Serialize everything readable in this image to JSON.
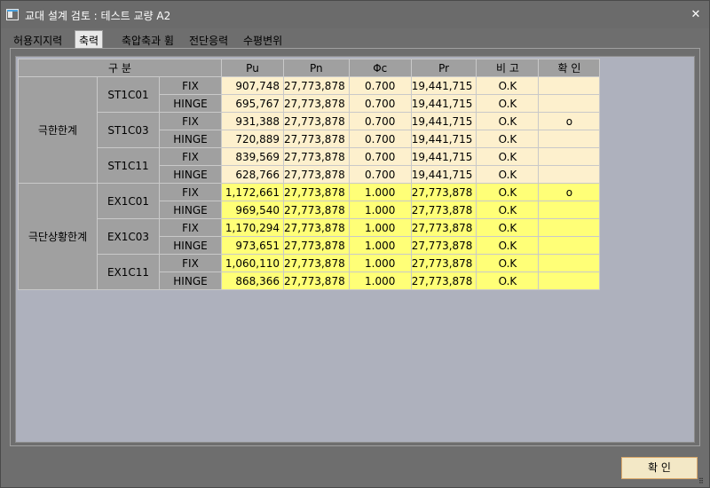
{
  "window": {
    "title": "교대 설계 검토 : 테스트 교량 A2",
    "close_glyph": "✕"
  },
  "tabs": [
    {
      "label": "허용지지력",
      "active": false
    },
    {
      "label": "축력",
      "active": true
    },
    {
      "label": "축압축과 휨",
      "active": false
    },
    {
      "label": "전단응력",
      "active": false
    },
    {
      "label": "수평변위",
      "active": false
    }
  ],
  "table": {
    "headers": {
      "category": "구 분",
      "pu": "Pu",
      "pn": "Pn",
      "phic": "Φc",
      "pr": "Pr",
      "remark": "비 고",
      "check": "확 인"
    },
    "groups": [
      {
        "label": "극한한계",
        "kind": "st",
        "subgroups": [
          {
            "label": "ST1C01",
            "rows": [
              {
                "type": "FIX",
                "pu": "907,748",
                "pn": "27,773,878",
                "phic": "0.700",
                "pr": "19,441,715",
                "remark": "O.K",
                "check": ""
              },
              {
                "type": "HINGE",
                "pu": "695,767",
                "pn": "27,773,878",
                "phic": "0.700",
                "pr": "19,441,715",
                "remark": "O.K",
                "check": ""
              }
            ]
          },
          {
            "label": "ST1C03",
            "rows": [
              {
                "type": "FIX",
                "pu": "931,388",
                "pn": "27,773,878",
                "phic": "0.700",
                "pr": "19,441,715",
                "remark": "O.K",
                "check": "o"
              },
              {
                "type": "HINGE",
                "pu": "720,889",
                "pn": "27,773,878",
                "phic": "0.700",
                "pr": "19,441,715",
                "remark": "O.K",
                "check": ""
              }
            ]
          },
          {
            "label": "ST1C11",
            "rows": [
              {
                "type": "FIX",
                "pu": "839,569",
                "pn": "27,773,878",
                "phic": "0.700",
                "pr": "19,441,715",
                "remark": "O.K",
                "check": ""
              },
              {
                "type": "HINGE",
                "pu": "628,766",
                "pn": "27,773,878",
                "phic": "0.700",
                "pr": "19,441,715",
                "remark": "O.K",
                "check": ""
              }
            ]
          }
        ]
      },
      {
        "label": "극단상황한계",
        "kind": "ex",
        "subgroups": [
          {
            "label": "EX1C01",
            "rows": [
              {
                "type": "FIX",
                "pu": "1,172,661",
                "pn": "27,773,878",
                "phic": "1.000",
                "pr": "27,773,878",
                "remark": "O.K",
                "check": "o"
              },
              {
                "type": "HINGE",
                "pu": "969,540",
                "pn": "27,773,878",
                "phic": "1.000",
                "pr": "27,773,878",
                "remark": "O.K",
                "check": ""
              }
            ]
          },
          {
            "label": "EX1C03",
            "rows": [
              {
                "type": "FIX",
                "pu": "1,170,294",
                "pn": "27,773,878",
                "phic": "1.000",
                "pr": "27,773,878",
                "remark": "O.K",
                "check": ""
              },
              {
                "type": "HINGE",
                "pu": "973,651",
                "pn": "27,773,878",
                "phic": "1.000",
                "pr": "27,773,878",
                "remark": "O.K",
                "check": ""
              }
            ]
          },
          {
            "label": "EX1C11",
            "rows": [
              {
                "type": "FIX",
                "pu": "1,060,110",
                "pn": "27,773,878",
                "phic": "1.000",
                "pr": "27,773,878",
                "remark": "O.K",
                "check": ""
              },
              {
                "type": "HINGE",
                "pu": "868,366",
                "pn": "27,773,878",
                "phic": "1.000",
                "pr": "27,773,878",
                "remark": "O.K",
                "check": ""
              }
            ]
          }
        ]
      }
    ]
  },
  "footer": {
    "confirm_label": "확 인",
    "resize_grip_glyph": "⠿"
  },
  "colors": {
    "ultimate_row_bg": "#fdf0cd",
    "extreme_row_bg": "#ffff77",
    "header_bg": "#a0a0a0",
    "grid_bg": "#aeb1bd",
    "confirm_bg": "#f3e8c6"
  }
}
